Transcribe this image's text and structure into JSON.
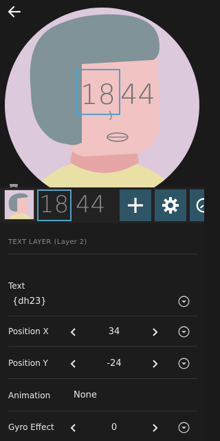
{
  "colors": {
    "background": "#1a1a1a",
    "face_bg": "#dcc9dc",
    "hair": "#7f9398",
    "skin": "#f1c3c3",
    "neck": "#e7a6a6",
    "shirt": "#e9e0a6",
    "accent": "#4fa3c8",
    "tool_button": "#2e5566"
  },
  "preview": {
    "time_hour": "18",
    "time_minute": "44",
    "icons": [
      "back-arrow-icon",
      "watch-icon",
      "undo-icon"
    ]
  },
  "layers": {
    "text_thumb_hour": "18",
    "text_thumb_minute": "44",
    "tools": [
      "add-icon",
      "gear-icon",
      "clock-icon"
    ]
  },
  "panel": {
    "section_title": "TEXT LAYER",
    "section_subtitle": "(Layer 2)",
    "text": {
      "label": "Text",
      "value": "{dh23}"
    },
    "position_x": {
      "label": "Position X",
      "value": "34"
    },
    "position_y": {
      "label": "Position Y",
      "value": "-24"
    },
    "animation": {
      "label": "Animation",
      "value": "None"
    },
    "gyro": {
      "label": "Gyro Effect",
      "value": "0"
    }
  }
}
